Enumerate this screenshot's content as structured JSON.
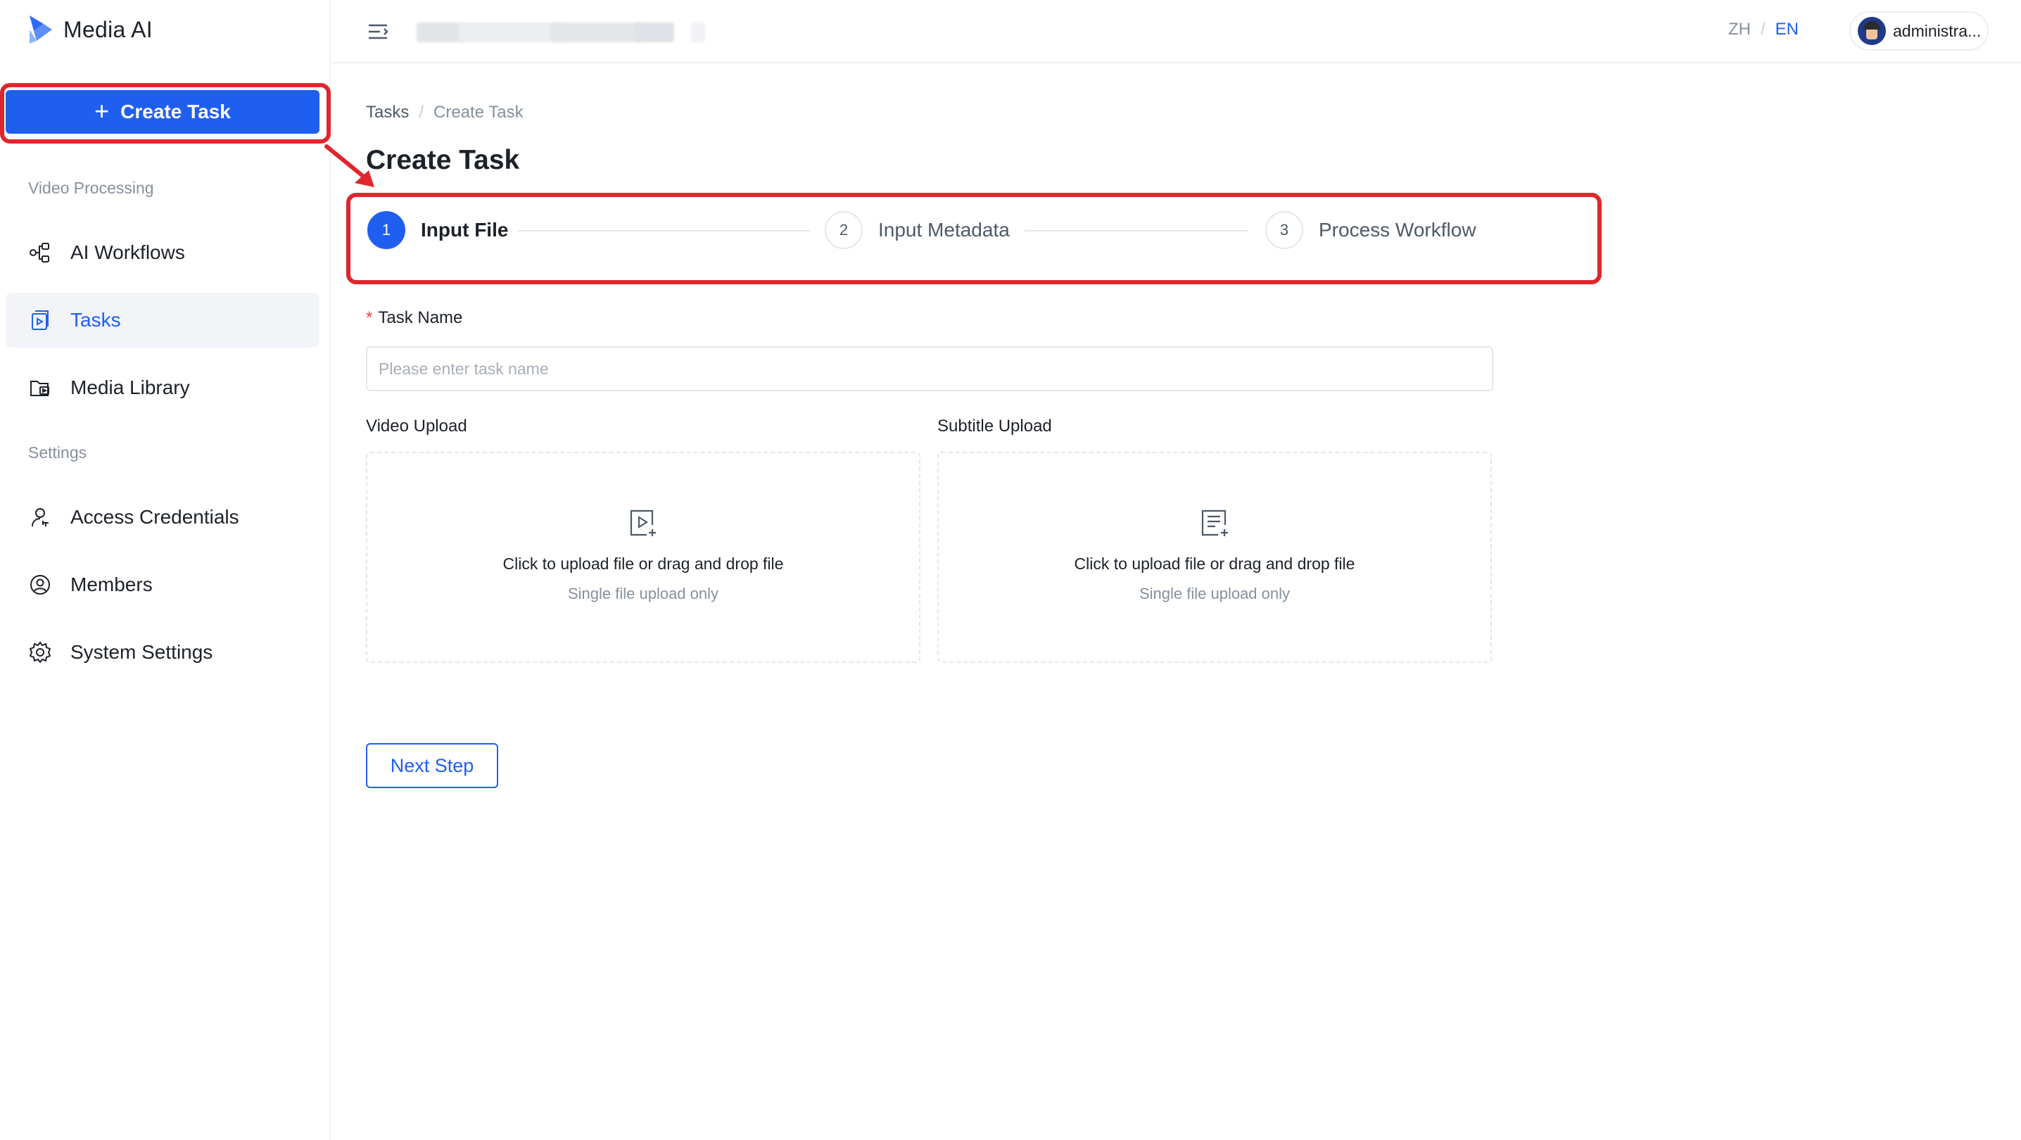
{
  "app": {
    "name": "Media AI"
  },
  "sidebar": {
    "create_button": "Create Task",
    "sections": [
      {
        "label": "Video Processing"
      },
      {
        "label": "Settings"
      }
    ],
    "items": [
      {
        "label": "AI Workflows",
        "icon": "workflow-icon",
        "active": false
      },
      {
        "label": "Tasks",
        "icon": "tasks-icon",
        "active": true
      },
      {
        "label": "Media Library",
        "icon": "media-library-icon",
        "active": false
      },
      {
        "label": "Access Credentials",
        "icon": "key-user-icon",
        "active": false
      },
      {
        "label": "Members",
        "icon": "members-icon",
        "active": false
      },
      {
        "label": "System Settings",
        "icon": "gear-icon",
        "active": false
      }
    ]
  },
  "header": {
    "lang_zh": "ZH",
    "lang_sep": "/",
    "lang_en": "EN",
    "user_name": "administra..."
  },
  "breadcrumb": {
    "root": "Tasks",
    "sep": "/",
    "current": "Create Task"
  },
  "page": {
    "title": "Create Task"
  },
  "steps": [
    {
      "number": "1",
      "label": "Input File",
      "active": true
    },
    {
      "number": "2",
      "label": "Input Metadata",
      "active": false
    },
    {
      "number": "3",
      "label": "Process Workflow",
      "active": false
    }
  ],
  "form": {
    "task_name": {
      "required_mark": "*",
      "label": "Task Name",
      "placeholder": "Please enter task name",
      "value": ""
    },
    "video_upload": {
      "label": "Video Upload",
      "main_text": "Click to upload file or drag and drop file",
      "sub_text": "Single file upload only"
    },
    "subtitle_upload": {
      "label": "Subtitle Upload",
      "main_text": "Click to upload file or drag and drop file",
      "sub_text": "Single file upload only"
    },
    "next_button": "Next Step"
  },
  "colors": {
    "primary": "#1f5ff0",
    "annotation": "#e0262b",
    "required": "#f53f3f"
  }
}
